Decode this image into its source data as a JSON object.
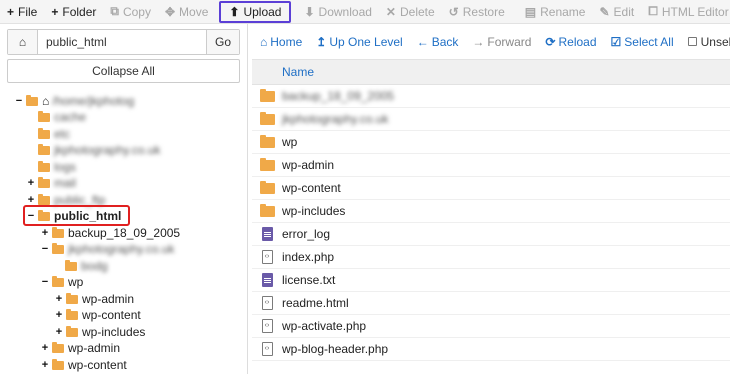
{
  "toolbar": {
    "file": "File",
    "folder": "Folder",
    "copy": "Copy",
    "move": "Move",
    "upload": "Upload",
    "download": "Download",
    "delete": "Delete",
    "restore": "Restore",
    "rename": "Rename",
    "edit": "Edit",
    "html_editor": "HTML Editor"
  },
  "pathbar": {
    "path_value": "public_html",
    "go_label": "Go"
  },
  "collapse_all": "Collapse All",
  "tree": [
    {
      "label": "/home/jkphotog",
      "toggle": "−",
      "icon": "home-icon",
      "blurred": true
    },
    {
      "label": "cache",
      "toggle": "",
      "blurred": true
    },
    {
      "label": "etc",
      "toggle": "",
      "blurred": true
    },
    {
      "label": "jkphotography.co.uk",
      "toggle": "",
      "blurred": true
    },
    {
      "label": "logs",
      "toggle": "",
      "blurred": true
    },
    {
      "label": "mail",
      "toggle": "+",
      "blurred": true
    },
    {
      "label": "public_ftp",
      "toggle": "+",
      "blurred": true
    },
    {
      "label": "public_html",
      "toggle": "−",
      "selected": true
    },
    {
      "label": "backup_18_09_2005",
      "toggle": "+"
    },
    {
      "label": "jkphotography.co.uk",
      "toggle": "−",
      "blurred": true
    },
    {
      "label": "bodg",
      "toggle": "",
      "blurred": true
    },
    {
      "label": "wp",
      "toggle": "−"
    },
    {
      "label": "wp-admin",
      "toggle": "+"
    },
    {
      "label": "wp-content",
      "toggle": "+"
    },
    {
      "label": "wp-includes",
      "toggle": "+"
    },
    {
      "label": "wp-admin",
      "toggle": "+"
    },
    {
      "label": "wp-content",
      "toggle": "+"
    }
  ],
  "nav": {
    "home": "Home",
    "up_one_level": "Up One Level",
    "back": "Back",
    "forward": "Forward",
    "reload": "Reload",
    "select_all": "Select All",
    "unselect_all": "Unselect All"
  },
  "file_list": {
    "column_name": "Name",
    "rows": [
      {
        "name": "backup_18_09_2005",
        "type": "folder",
        "blurred": true
      },
      {
        "name": "jkphotography.co.uk",
        "type": "folder",
        "blurred": true
      },
      {
        "name": "wp",
        "type": "folder"
      },
      {
        "name": "wp-admin",
        "type": "folder"
      },
      {
        "name": "wp-content",
        "type": "folder"
      },
      {
        "name": "wp-includes",
        "type": "folder"
      },
      {
        "name": "error_log",
        "type": "text"
      },
      {
        "name": "index.php",
        "type": "code"
      },
      {
        "name": "license.txt",
        "type": "text"
      },
      {
        "name": "readme.html",
        "type": "code"
      },
      {
        "name": "wp-activate.php",
        "type": "code"
      },
      {
        "name": "wp-blog-header.php",
        "type": "code"
      }
    ]
  },
  "colors": {
    "accent": "#1f6fc5",
    "folder": "#f0a948",
    "upload_highlight": "#5b3fd6",
    "selection_highlight": "#e02020"
  }
}
